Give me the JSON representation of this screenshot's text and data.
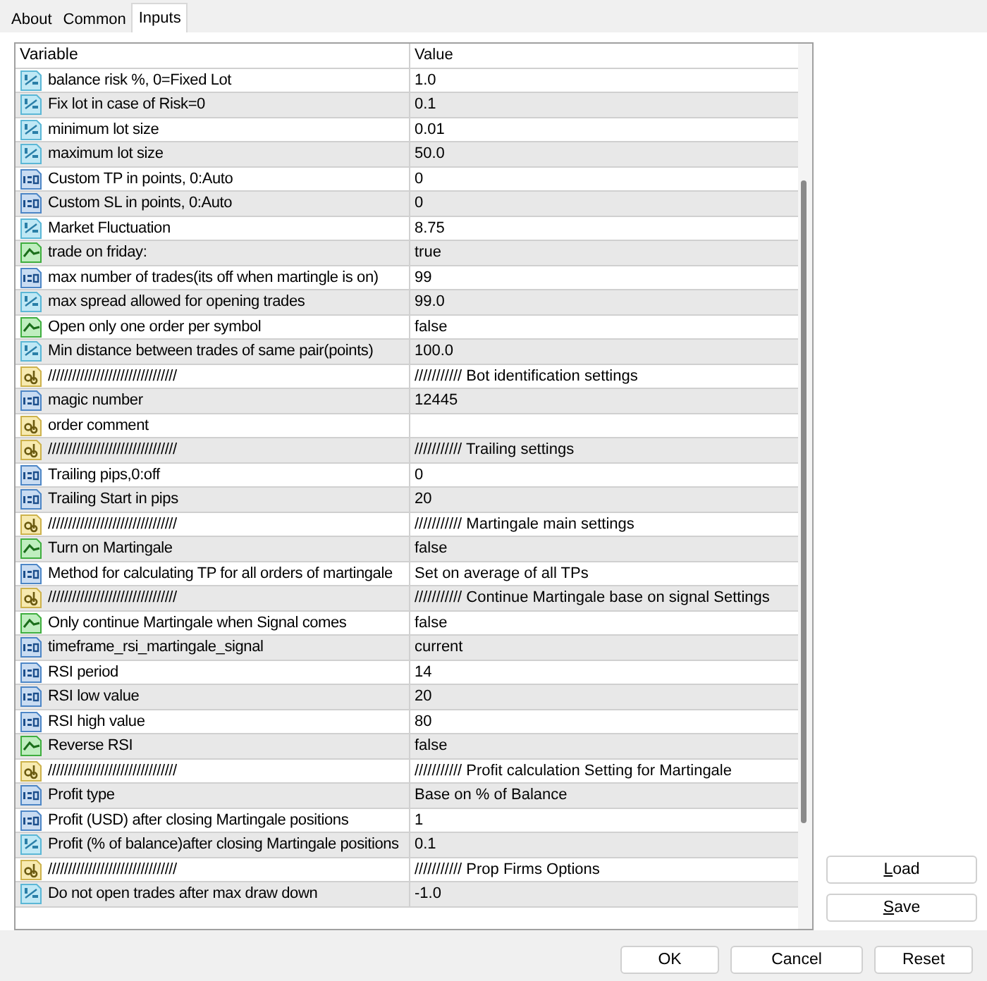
{
  "tabs": [
    {
      "label": "About",
      "selected": false
    },
    {
      "label": "Common",
      "selected": false
    },
    {
      "label": "Inputs",
      "selected": true
    }
  ],
  "table": {
    "columns": [
      "Variable",
      "Value"
    ],
    "rows": [
      {
        "kind": "double",
        "variable": "balance risk %, 0=Fixed Lot",
        "value": "1.0"
      },
      {
        "kind": "double",
        "variable": "Fix lot in case of Risk=0",
        "value": "0.1"
      },
      {
        "kind": "double",
        "variable": "minimum lot size",
        "value": "0.01"
      },
      {
        "kind": "double",
        "variable": "maximum lot size",
        "value": "50.0"
      },
      {
        "kind": "int",
        "variable": "Custom TP in points, 0:Auto",
        "value": "0"
      },
      {
        "kind": "int",
        "variable": "Custom SL in points, 0:Auto",
        "value": "0"
      },
      {
        "kind": "double",
        "variable": "Market Fluctuation",
        "value": "8.75"
      },
      {
        "kind": "bool",
        "variable": "trade on friday:",
        "value": "true"
      },
      {
        "kind": "int",
        "variable": "max number of trades(its off when martingle is on)",
        "value": "99"
      },
      {
        "kind": "double",
        "variable": "max spread allowed for opening trades",
        "value": "99.0"
      },
      {
        "kind": "bool",
        "variable": "Open only one order per symbol",
        "value": "false"
      },
      {
        "kind": "double",
        "variable": "Min distance between trades of same pair(points)",
        "value": "100.0"
      },
      {
        "kind": "string",
        "variable": "////////////////////////////////",
        "value": "/////////// Bot identification settings"
      },
      {
        "kind": "int",
        "variable": "magic number",
        "value": "12445"
      },
      {
        "kind": "string",
        "variable": "order comment"
      },
      {
        "kind": "string",
        "variable": "////////////////////////////////",
        "value": "/////////// Trailing settings"
      },
      {
        "kind": "int",
        "variable": "Trailing pips,0:off",
        "value": "0"
      },
      {
        "kind": "int",
        "variable": "Trailing Start in pips",
        "value": "20"
      },
      {
        "kind": "string",
        "variable": "////////////////////////////////",
        "value": "/////////// Martingale main settings"
      },
      {
        "kind": "bool",
        "variable": "Turn on Martingale",
        "value": "false"
      },
      {
        "kind": "int",
        "variable": "Method for calculating TP for all orders of martingale",
        "value": "Set on average of all TPs"
      },
      {
        "kind": "string",
        "variable": "////////////////////////////////",
        "value": "/////////// Continue Martingale base on signal Settings"
      },
      {
        "kind": "bool",
        "variable": "Only continue Martingale when Signal comes",
        "value": "false"
      },
      {
        "kind": "int",
        "variable": "timeframe_rsi_martingale_signal",
        "value": "current"
      },
      {
        "kind": "int",
        "variable": "RSI period",
        "value": "14"
      },
      {
        "kind": "int",
        "variable": "RSI low value",
        "value": "20"
      },
      {
        "kind": "int",
        "variable": "RSI high value",
        "value": "80"
      },
      {
        "kind": "bool",
        "variable": "Reverse RSI",
        "value": "false"
      },
      {
        "kind": "string",
        "variable": "////////////////////////////////",
        "value": "/////////// Profit calculation Setting for Martingale"
      },
      {
        "kind": "int",
        "variable": "Profit type",
        "value": "Base on % of Balance"
      },
      {
        "kind": "int",
        "variable": "Profit (USD) after closing Martingale positions",
        "value": "1"
      },
      {
        "kind": "double",
        "variable": "Profit (% of balance)after closing Martingale positions",
        "value": "0.1"
      },
      {
        "kind": "string",
        "variable": "////////////////////////////////",
        "value": "/////////// Prop Firms Options"
      },
      {
        "kind": "double",
        "variable": "Do not open trades after max draw down",
        "value": "-1.0"
      }
    ]
  },
  "side_buttons": [
    "Load",
    "Save"
  ],
  "footer_buttons": [
    "OK",
    "Cancel",
    "Reset"
  ]
}
